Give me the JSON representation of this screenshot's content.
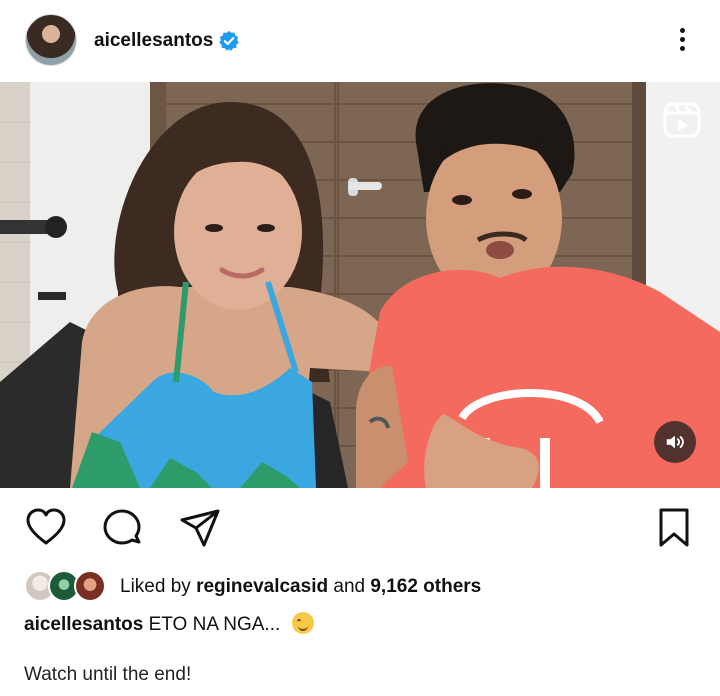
{
  "post": {
    "username": "aicellesantos",
    "verified": true
  },
  "media": {
    "type": "reel",
    "reels_icon": "reels-icon",
    "sound_icon": "speaker-icon"
  },
  "actions": {
    "like_icon": "heart-icon",
    "comment_icon": "comment-icon",
    "share_icon": "send-icon",
    "save_icon": "bookmark-icon"
  },
  "likes": {
    "prefix": "Liked by",
    "liked_user": "reginevalcasid",
    "conjunction": "and",
    "others_count": "9,162 others"
  },
  "caption": {
    "username": "aicellesantos",
    "text": "ETO NA NGA...",
    "emoji": "grinning-face-emoji"
  },
  "comment_text": "Watch until the end!",
  "colors": {
    "verified_blue": "#1d9bf0",
    "shirt_coral": "#f46a5e",
    "swimsuit_blue": "#3aa7e0"
  }
}
